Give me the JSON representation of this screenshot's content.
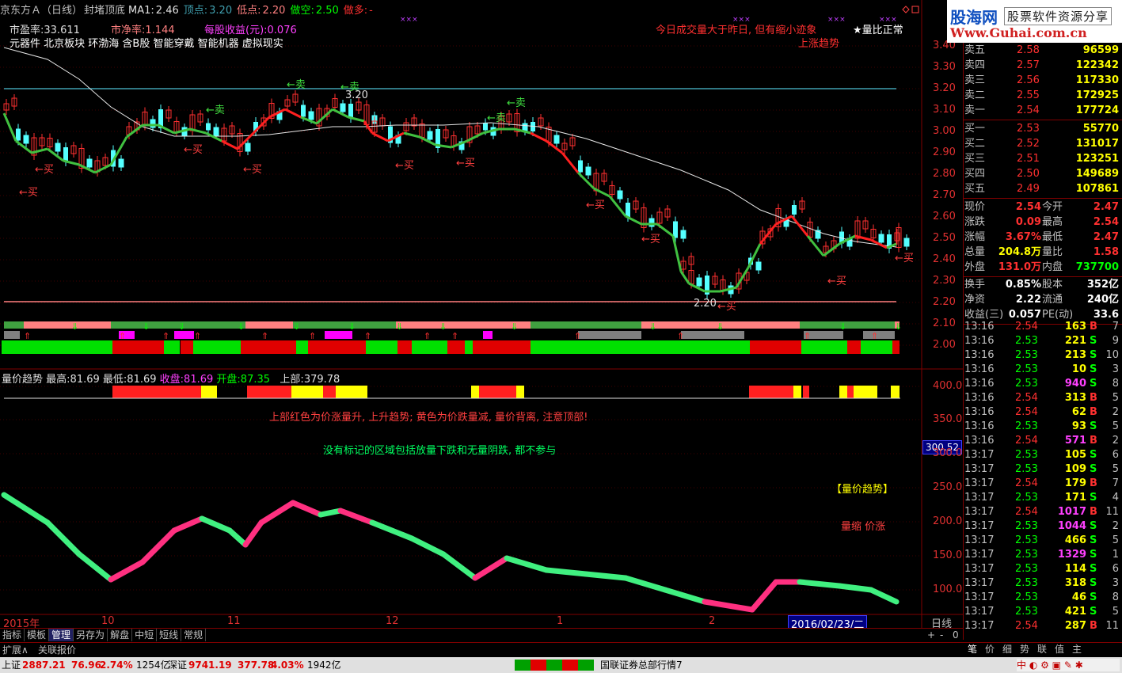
{
  "header": {
    "title": "京东方Ａ（日线）",
    "indicator": "封堵顶底",
    "ma1_label": "MA1:",
    "ma1_value": "2.46",
    "top_label": "顶点:",
    "top_value": "3.20",
    "low_label": "低点:",
    "low_value": "2.20",
    "short_label": "做空:",
    "short_value": "2.50",
    "long_label": "做多:",
    "long_value": "-"
  },
  "info": {
    "pe_label": "市盈率:",
    "pe_value": "33.611",
    "pb_label": "市净率:",
    "pb_value": "1.144",
    "eps_label": "每股收益(元):",
    "eps_value": "0.076",
    "concepts": "元器件 北京板块 环渤海 含B股 智能穿戴 智能机器 虚拟现实",
    "vol_note": "今日成交量大于昨日, 但有缩小迹象",
    "vol_ratio": "★量比正常",
    "trend_note": "上涨趋势"
  },
  "chart_marks": {
    "buy": "←买",
    "sell": "←卖",
    "top_price": "3.20",
    "low_price": "2.20"
  },
  "price_axis": [
    "3.40",
    "3.30",
    "3.20",
    "3.10",
    "3.00",
    "2.90",
    "2.80",
    "2.70",
    "2.60",
    "2.50",
    "2.40",
    "2.30",
    "2.20",
    "2.10",
    "2.00"
  ],
  "sub": {
    "title": "量价趋势",
    "max_label": "最高:",
    "max_value": "81.69",
    "min_label": "最低:",
    "min_value": "81.69",
    "gain_label": "收盘:",
    "gain_value": "81.69",
    "open_label": "开盘:",
    "open_value": "87.35",
    "upper_label": "上部:",
    "upper_value": "379.78",
    "note1": "上部红色为价涨量升, 上升趋势; 黄色为价跌量减, 量价背离, 注意顶部!",
    "note2": "没有标记的区域包括放量下跌和无量阴跌, 都不参与",
    "tag": "【量价趋势】",
    "legend_a": "量缩",
    "legend_b": "价涨",
    "cursor_value": "300.52"
  },
  "sub_axis": [
    "400.0",
    "350.0",
    "300.0",
    "250.0",
    "200.0",
    "150.0",
    "100.0"
  ],
  "date_axis": {
    "year": "2015年",
    "m10": "10",
    "m11": "11",
    "m12": "12",
    "m1": "1",
    "m2": "2",
    "cursor_date": "2016/02/23/二",
    "period": "日线"
  },
  "toolbar": [
    "指标",
    "模板",
    "管理",
    "另存为",
    "解盘",
    "中短",
    "短线",
    "常规"
  ],
  "toolbar2": [
    "扩展∧",
    "关联报价"
  ],
  "logo": {
    "l1": "股海网",
    "l1b": "股票软件资源分享",
    "l2": "Www.Guhai.com.cn"
  },
  "order_book": {
    "asks": [
      {
        "label": "卖五",
        "price": "2.58",
        "vol": "96599"
      },
      {
        "label": "卖四",
        "price": "2.57",
        "vol": "122342"
      },
      {
        "label": "卖三",
        "price": "2.56",
        "vol": "117330"
      },
      {
        "label": "卖二",
        "price": "2.55",
        "vol": "172925"
      },
      {
        "label": "卖一",
        "price": "2.54",
        "vol": "177724"
      }
    ],
    "bids": [
      {
        "label": "买一",
        "price": "2.53",
        "vol": "55770"
      },
      {
        "label": "买二",
        "price": "2.52",
        "vol": "131017"
      },
      {
        "label": "买三",
        "price": "2.51",
        "vol": "123251"
      },
      {
        "label": "买四",
        "price": "2.50",
        "vol": "149689"
      },
      {
        "label": "买五",
        "price": "2.49",
        "vol": "107861"
      }
    ]
  },
  "quote": [
    {
      "a": "现价",
      "b": "2.54",
      "c": "今开",
      "d": "2.47"
    },
    {
      "a": "涨跌",
      "b": "0.09",
      "c": "最高",
      "d": "2.54"
    },
    {
      "a": "涨幅",
      "b": "3.67%",
      "c": "最低",
      "d": "2.47"
    },
    {
      "a": "总量",
      "b": "204.8万",
      "c": "量比",
      "d": "1.58"
    },
    {
      "a": "外盘",
      "b": "131.0万",
      "c": "内盘",
      "d": "737700"
    },
    {
      "a": "换手",
      "b": "0.85%",
      "c": "股本",
      "d": "352亿"
    },
    {
      "a": "净资",
      "b": "2.22",
      "c": "流通",
      "d": "240亿"
    },
    {
      "a": "收益(三)",
      "b": "0.057",
      "c": "PE(动)",
      "d": "33.6"
    }
  ],
  "trades": [
    {
      "t": "13:16",
      "p": "2.54",
      "v": "163",
      "s": "B",
      "n": "7"
    },
    {
      "t": "13:16",
      "p": "2.53",
      "v": "221",
      "s": "S",
      "n": "9"
    },
    {
      "t": "13:16",
      "p": "2.53",
      "v": "213",
      "s": "S",
      "n": "10"
    },
    {
      "t": "13:16",
      "p": "2.53",
      "v": "10",
      "s": "S",
      "n": "3"
    },
    {
      "t": "13:16",
      "p": "2.53",
      "v": "940",
      "s": "S",
      "n": "8"
    },
    {
      "t": "13:16",
      "p": "2.54",
      "v": "313",
      "s": "B",
      "n": "5"
    },
    {
      "t": "13:16",
      "p": "2.54",
      "v": "62",
      "s": "B",
      "n": "2"
    },
    {
      "t": "13:16",
      "p": "2.53",
      "v": "93",
      "s": "S",
      "n": "5"
    },
    {
      "t": "13:16",
      "p": "2.54",
      "v": "571",
      "s": "B",
      "n": "2"
    },
    {
      "t": "13:17",
      "p": "2.53",
      "v": "105",
      "s": "S",
      "n": "6"
    },
    {
      "t": "13:17",
      "p": "2.53",
      "v": "109",
      "s": "S",
      "n": "5"
    },
    {
      "t": "13:17",
      "p": "2.54",
      "v": "179",
      "s": "B",
      "n": "7"
    },
    {
      "t": "13:17",
      "p": "2.53",
      "v": "171",
      "s": "S",
      "n": "4"
    },
    {
      "t": "13:17",
      "p": "2.54",
      "v": "1017",
      "s": "B",
      "n": "11"
    },
    {
      "t": "13:17",
      "p": "2.53",
      "v": "1044",
      "s": "S",
      "n": "2"
    },
    {
      "t": "13:17",
      "p": "2.53",
      "v": "466",
      "s": "S",
      "n": "5"
    },
    {
      "t": "13:17",
      "p": "2.53",
      "v": "1329",
      "s": "S",
      "n": "1"
    },
    {
      "t": "13:17",
      "p": "2.53",
      "v": "114",
      "s": "S",
      "n": "6"
    },
    {
      "t": "13:17",
      "p": "2.53",
      "v": "318",
      "s": "S",
      "n": "3"
    },
    {
      "t": "13:17",
      "p": "2.53",
      "v": "46",
      "s": "S",
      "n": "8"
    },
    {
      "t": "13:17",
      "p": "2.53",
      "v": "421",
      "s": "S",
      "n": "5"
    },
    {
      "t": "13:17",
      "p": "2.54",
      "v": "287",
      "s": "B",
      "n": "11"
    }
  ],
  "rp_tabs": [
    "笔",
    "价",
    "细",
    "势",
    "联",
    "值",
    "主"
  ],
  "status": {
    "sh_label": "上证",
    "sh_value": "2887.21",
    "sh_chg": "76.96",
    "sh_pct": "2.74%",
    "sh_amt": "1254亿",
    "sz_label": "深证",
    "sz_value": "9741.19",
    "sz_chg": "377.78",
    "sz_pct": "4.03%",
    "sz_amt": "1942亿",
    "server": "国联证券总部行情7"
  },
  "colors": {
    "up": "#ff3030",
    "down": "#54ffff",
    "ma": "#e0e0e0",
    "green": "#00ff00",
    "yellow": "#ffff00"
  }
}
